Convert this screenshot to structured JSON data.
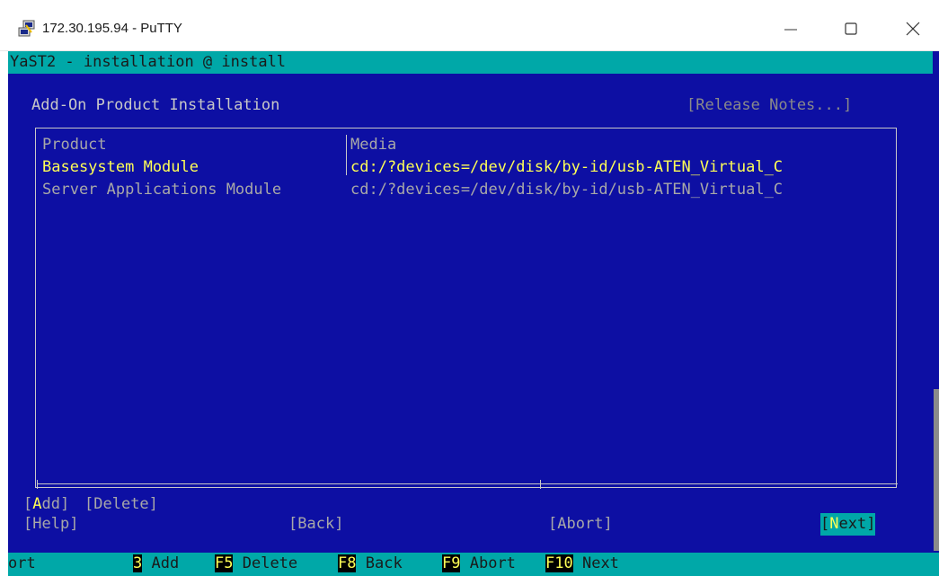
{
  "window": {
    "title": "172.30.195.94 - PuTTY",
    "icons": {
      "app": "putty-icon",
      "minimize": "minimize-icon",
      "maximize": "maximize-icon",
      "close": "close-icon"
    }
  },
  "terminal": {
    "topbar": "YaST2 - installation @ install",
    "heading": "Add-On Product Installation",
    "release_notes": "[Release Notes...]",
    "table": {
      "headers": [
        "Product",
        "Media"
      ],
      "rows": [
        {
          "product": "Basesystem Module",
          "media": "cd:/?devices=/dev/disk/by-id/usb-ATEN_Virtual_C"
        },
        {
          "product": "Server Applications Module",
          "media": "cd:/?devices=/dev/disk/by-id/usb-ATEN_Virtual_C"
        }
      ]
    },
    "buttons": {
      "add_hot": "A",
      "add_rest": "dd",
      "delete": "Delete",
      "help": "Help",
      "back": "Back",
      "abort": "Abort",
      "next_hot": "N",
      "next_rest": "ext"
    },
    "fkeys": {
      "partial": "ort",
      "items": [
        {
          "key": "3",
          "label": "Add"
        },
        {
          "key": "F5",
          "label": "Delete"
        },
        {
          "key": "F8",
          "label": "Back"
        },
        {
          "key": "F9",
          "label": "Abort"
        },
        {
          "key": "F10",
          "label": "Next"
        }
      ]
    },
    "colors": {
      "background": "#0d0fa3",
      "accent": "#00a8a8",
      "highlight": "#ffff55"
    }
  }
}
